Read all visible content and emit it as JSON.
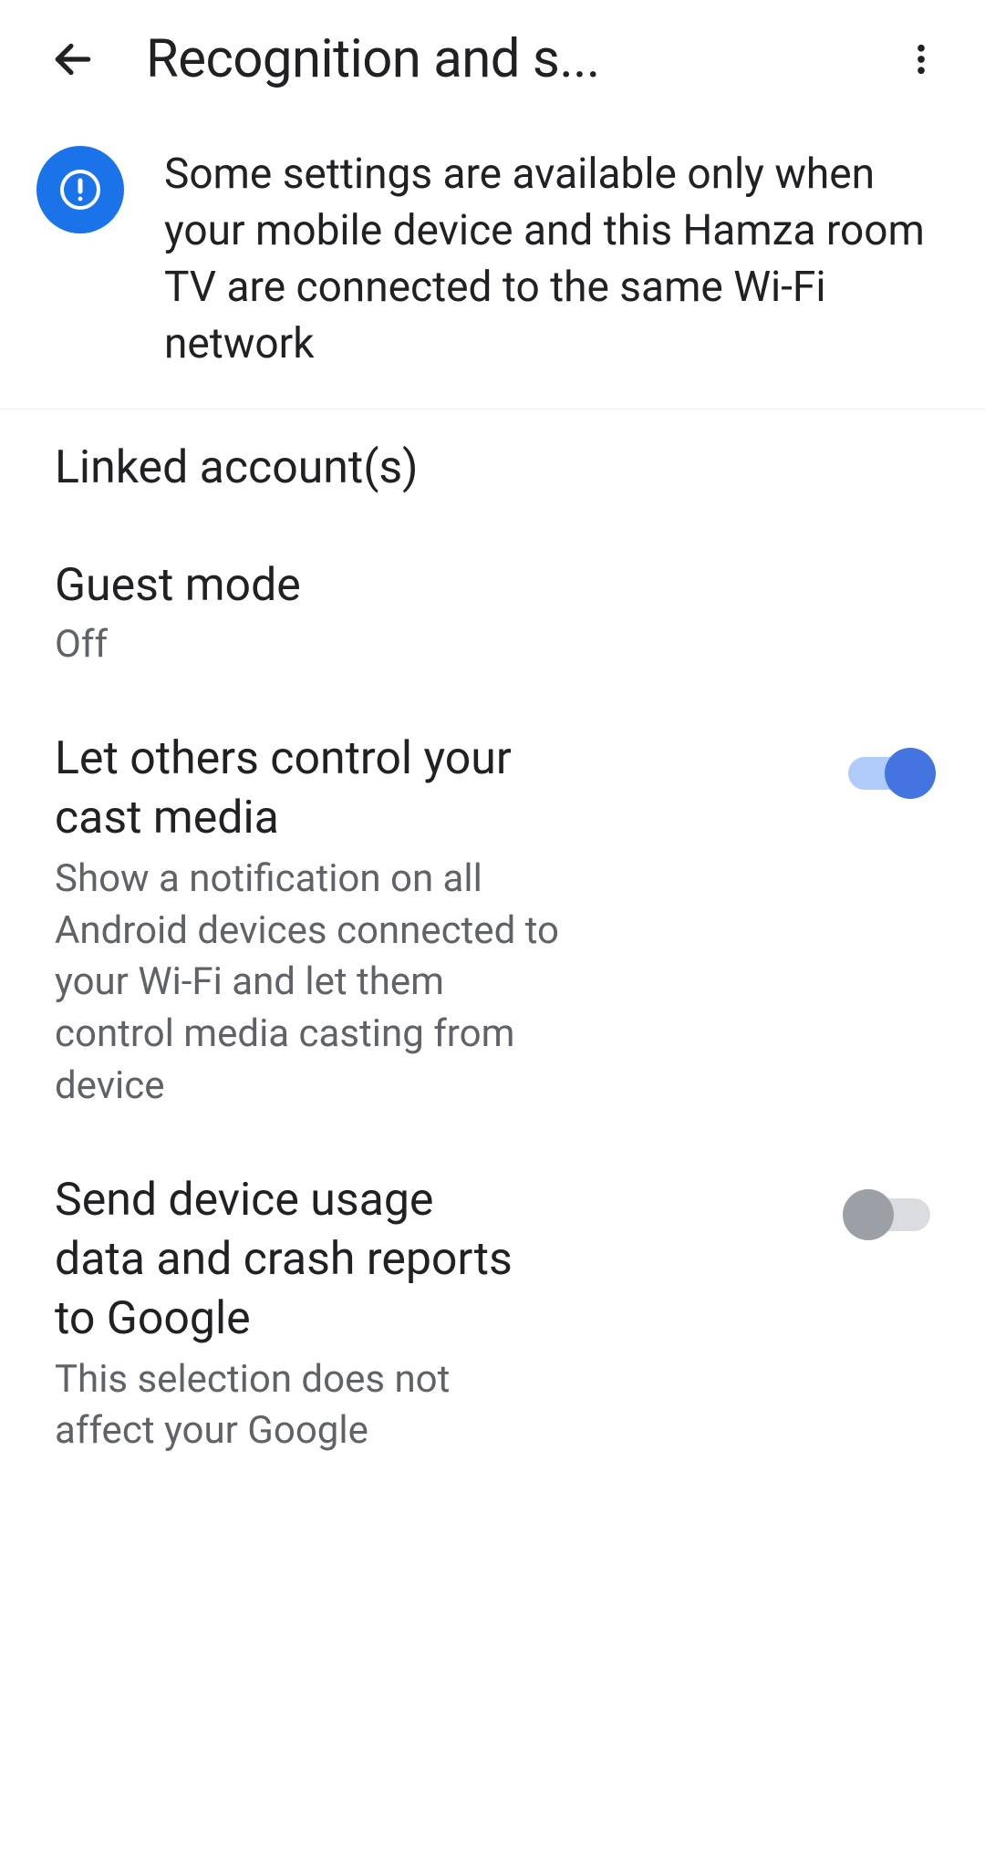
{
  "header": {
    "title": "Recognition and s..."
  },
  "banner": {
    "text": "Some settings are available only when your mobile device and this Hamza room TV are connected to the same Wi-Fi network"
  },
  "settings": {
    "linked_accounts": {
      "title": "Linked account(s)"
    },
    "guest_mode": {
      "title": "Guest mode",
      "subtitle": "Off"
    },
    "cast_control": {
      "title": "Let others control your cast media",
      "description": "Show a notification on all Android devices connected to your Wi-Fi and let them control media casting from device",
      "enabled": true
    },
    "usage_data": {
      "title": "Send device usage data and crash reports to Google",
      "description": "This selection does not affect your Google",
      "enabled": false
    }
  }
}
